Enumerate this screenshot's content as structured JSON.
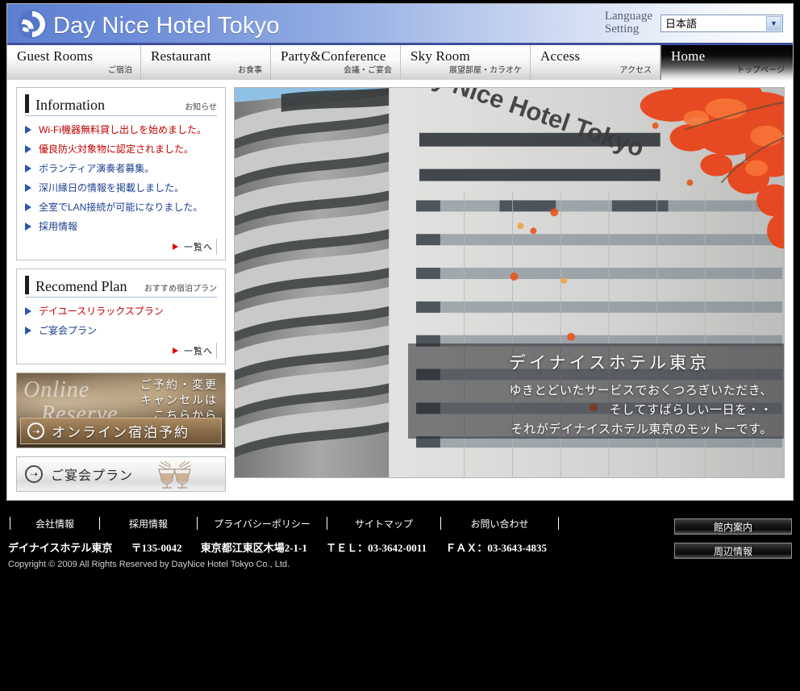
{
  "header": {
    "logo_icon": "wave-circle-logo-icon",
    "site_title": "Day Nice Hotel Tokyo",
    "language_label_line1": "Language",
    "language_label_line2": "Setting",
    "language_selected": "日本語",
    "language_options": [
      "日本語"
    ],
    "dropdown_icon": "chevron-down-icon"
  },
  "nav": {
    "items": [
      {
        "en": "Guest Rooms",
        "ja": "ご宿泊",
        "active": false
      },
      {
        "en": "Restaurant",
        "ja": "お食事",
        "active": false
      },
      {
        "en": "Party&Conference",
        "ja": "会議・ご宴会",
        "active": false
      },
      {
        "en": "Sky Room",
        "ja": "展望部屋・カラオケ",
        "active": false
      },
      {
        "en": "Access",
        "ja": "アクセス",
        "active": false
      },
      {
        "en": "Home",
        "ja": "トップページ",
        "active": true
      }
    ]
  },
  "information": {
    "title": "Information",
    "subtitle": "お知らせ",
    "items": [
      {
        "label": "Wi-Fi機器無料貸し出しを始めました。",
        "color": "red"
      },
      {
        "label": "優良防火対象物に認定されました。",
        "color": "red"
      },
      {
        "label": "ボランティア演奏者募集。",
        "color": "blue"
      },
      {
        "label": "深川縁日の情報を掲載しました。",
        "color": "blue"
      },
      {
        "label": "全室でLAN接続が可能になりました。",
        "color": "blue"
      },
      {
        "label": "採用情報",
        "color": "blue"
      }
    ],
    "more_label": "一覧へ"
  },
  "recommend": {
    "title": "Recomend Plan",
    "subtitle": "おすすめ宿泊プラン",
    "items": [
      {
        "label": "デイユースリラックスプラン",
        "color": "red"
      },
      {
        "label": "ご宴会プラン",
        "color": "blue"
      }
    ],
    "more_label": "一覧へ"
  },
  "reserve_banner": {
    "script_line1": "Online",
    "script_line2": "Reserve",
    "ja_line1": "ご予約・変更",
    "ja_line2": "キャンセルは",
    "ja_line3": "こちらから",
    "button_label": "オンライン宿泊予約",
    "arrow_icon": "arrow-right-circle-icon"
  },
  "party_banner": {
    "label": "ご宴会プラン",
    "arrow_icon": "arrow-right-circle-icon",
    "decor_icon": "wine-glasses-icon"
  },
  "hero": {
    "image_alt": "day-nice-hotel-tokyo-building-with-autumn-maple-leaves",
    "building_sign": "Day Nice Hotel Tokyo",
    "overlay_title": "デイナイスホテル東京",
    "overlay_lines": [
      "ゆきとどいたサービスでおくつろぎいただき、",
      "そしてすばらしい一日を・・",
      "それがデイナイスホテル東京のモットーです。"
    ]
  },
  "footer": {
    "links": [
      "会社情報",
      "採用情報",
      "プライバシーポリシー",
      "サイトマップ",
      "お問い合わせ"
    ],
    "hotel_name": "デイナイスホテル東京",
    "postal": "〒135-0042",
    "address": "東京都江東区木場2-1-1",
    "tel": "ＴＥＬ：03-3642-0011",
    "fax": "ＦＡＸ：03-3643-4835",
    "copyright": "Copyright © 2009 All Rights Reserved by DayNice Hotel Tokyo Co., Ltd.",
    "buttons": [
      "館内案内",
      "周辺情報"
    ]
  },
  "colors": {
    "header_blue": "#5c7fd1",
    "nav_border": "#3f4f9b",
    "link_blue": "#1c3f8f",
    "link_red": "#c00000",
    "arrow_blue": "#2a55b0",
    "more_red": "#e00000",
    "footer_bg": "#000000",
    "banner_brown": "#8a7155"
  }
}
